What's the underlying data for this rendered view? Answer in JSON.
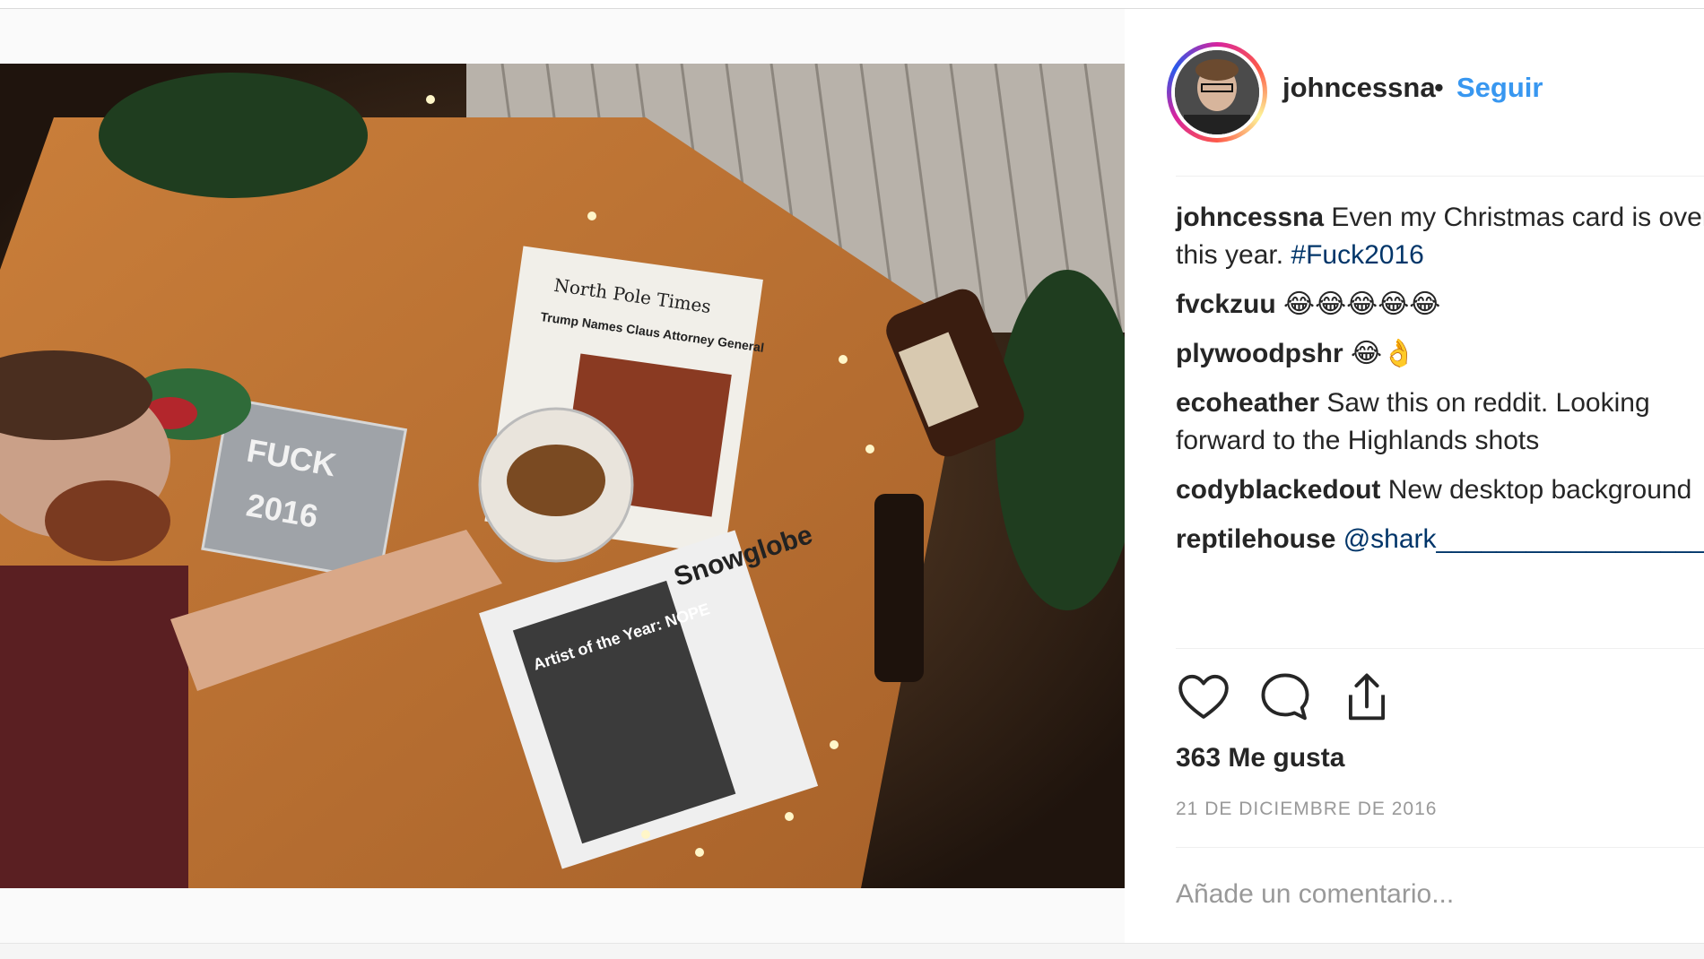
{
  "header": {
    "username": "johncessna",
    "separator": "•",
    "follow_label": "Seguir"
  },
  "comments": [
    {
      "user": "johncessna",
      "text": "Even my Christmas card is over",
      "text2": "this year.",
      "hashtag": "#Fuck2016"
    },
    {
      "user": "fvckzuu",
      "text": "😂😂😂😂😂"
    },
    {
      "user": "plywoodpshr",
      "text": "😂👌"
    },
    {
      "user": "ecoheather",
      "text": "Saw this on reddit. Looking forward to the Highlands shots"
    },
    {
      "user": "codyblackedout",
      "text": "New desktop background"
    },
    {
      "user": "reptilehouse",
      "mention": "@shark_____________________"
    }
  ],
  "actions": {
    "like_icon": "heart-icon",
    "comment_icon": "comment-bubble-icon",
    "share_icon": "share-icon"
  },
  "likes_text": "363 Me gusta",
  "date_text": "21 DE DICIEMBRE DE 2016",
  "comment_placeholder": "Añade un comentario...",
  "photo": {
    "newspaper1_masthead": "North Pole Times",
    "newspaper1_headline": "Trump Names Claus Attorney General",
    "newspaper2_masthead": "Snowglobe",
    "newspaper2_headline": "Artist of the Year: NOPE",
    "mirror_text_line1": "FUCK",
    "mirror_text_line2": "2016"
  },
  "colors": {
    "link_blue": "#3897f0",
    "hashtag_blue": "#003569",
    "muted_gray": "#999999"
  }
}
